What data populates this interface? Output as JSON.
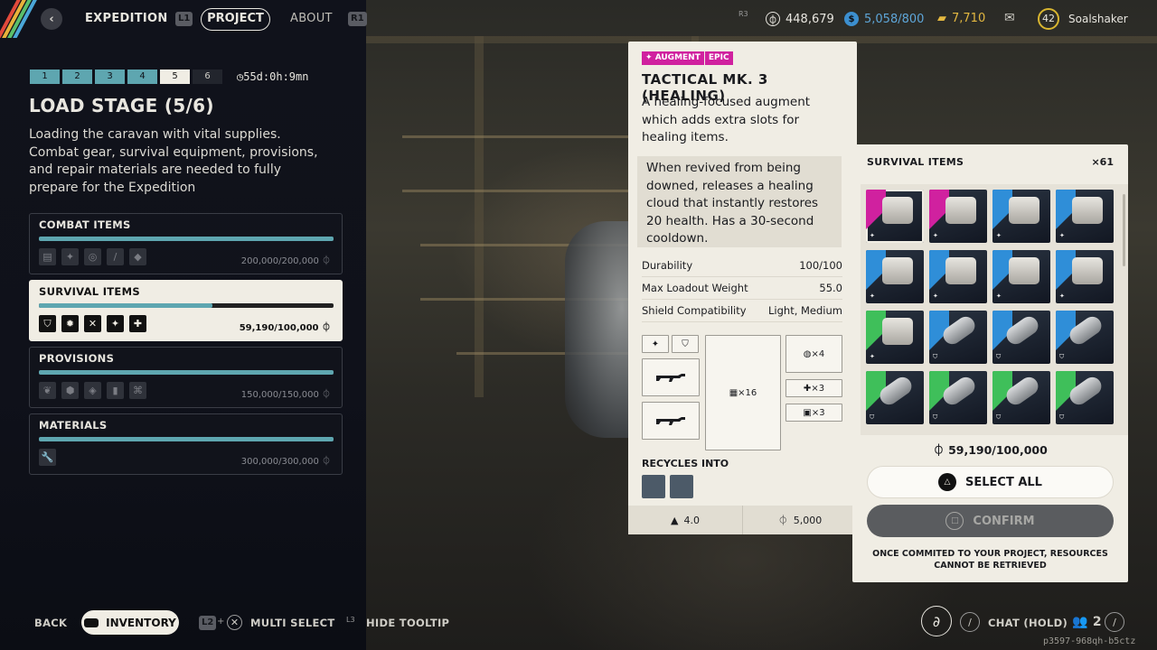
{
  "top_nav": {
    "back_label": "‹",
    "expedition": "EXPEDITION",
    "l1": "L1",
    "project": "PROJECT",
    "about": "ABOUT",
    "r1": "R1",
    "r3": "R3",
    "credits": "448,679",
    "bar_currency": "5,058/800",
    "premium": "7,710",
    "player_level": "42",
    "player_name": "Soalshaker"
  },
  "stage": {
    "steps": [
      "1",
      "2",
      "3",
      "4",
      "5",
      "6"
    ],
    "active_step": 5,
    "timer": "55d:0h:9mn",
    "title": "LOAD STAGE (5/6)",
    "description": "Loading the caravan with vital supplies. Combat gear, survival equipment, provisions, and repair materials are needed to fully prepare for the Expedition"
  },
  "categories": [
    {
      "name": "COMBAT ITEMS",
      "amount": "200,000/200,000",
      "progress": 1.0,
      "icons": [
        "▤",
        "✦",
        "◎",
        "/",
        "◆"
      ]
    },
    {
      "name": "SURVIVAL ITEMS",
      "amount": "59,190/100,000",
      "progress": 0.59,
      "icons": [
        "⛉",
        "✹",
        "✕",
        "✦",
        "✚"
      ]
    },
    {
      "name": "PROVISIONS",
      "amount": "150,000/150,000",
      "progress": 1.0,
      "icons": [
        "❦",
        "⬢",
        "◈",
        "▮",
        "⌘"
      ]
    },
    {
      "name": "MATERIALS",
      "amount": "300,000/300,000",
      "progress": 1.0,
      "icons": [
        "🔧"
      ]
    }
  ],
  "currency_symbol": "⏀",
  "tooltip": {
    "tag_type": "AUGMENT",
    "tag_rarity": "EPIC",
    "title": "TACTICAL MK. 3 (HEALING)",
    "description": "A healing-focused augment which adds extra slots for healing items.",
    "effect": "When revived from being downed, releases a healing cloud that instantly restores 20 health. Has a 30-second cooldown.",
    "stats": [
      {
        "label": "Durability",
        "value": "100/100"
      },
      {
        "label": "Max Loadout Weight",
        "value": "55.0"
      },
      {
        "label": "Shield Compatibility",
        "value": "Light, Medium"
      }
    ],
    "slots": {
      "backpack": "×16",
      "quick_use": "×4",
      "healing": "×3",
      "safe": "×3"
    },
    "recycles_label": "RECYCLES INTO",
    "weight": "4.0",
    "value": "5,000"
  },
  "survival_panel": {
    "title": "SURVIVAL ITEMS",
    "count": "×61",
    "total": "59,190/100,000",
    "select_all": "SELECT ALL",
    "confirm": "CONFIRM",
    "warning": "ONCE COMMITED TO YOUR PROJECT, RESOURCES CANNOT BE RETRIEVED",
    "items": [
      {
        "rarity": "#d0219f",
        "kind": "box",
        "mark": "✦"
      },
      {
        "rarity": "#d0219f",
        "kind": "box",
        "mark": "✦"
      },
      {
        "rarity": "#2f8ed8",
        "kind": "box",
        "mark": "✦"
      },
      {
        "rarity": "#2f8ed8",
        "kind": "box",
        "mark": "✦"
      },
      {
        "rarity": "#2f8ed8",
        "kind": "box",
        "mark": "✦"
      },
      {
        "rarity": "#2f8ed8",
        "kind": "box",
        "mark": "✦"
      },
      {
        "rarity": "#2f8ed8",
        "kind": "box",
        "mark": "✦"
      },
      {
        "rarity": "#2f8ed8",
        "kind": "box",
        "mark": "✦"
      },
      {
        "rarity": "#3fbf5a",
        "kind": "box",
        "mark": "✦"
      },
      {
        "rarity": "#2f8ed8",
        "kind": "tube",
        "mark": "⛉"
      },
      {
        "rarity": "#2f8ed8",
        "kind": "tube",
        "mark": "⛉"
      },
      {
        "rarity": "#2f8ed8",
        "kind": "tube",
        "mark": "⛉"
      },
      {
        "rarity": "#3fbf5a",
        "kind": "tube",
        "mark": "⛉"
      },
      {
        "rarity": "#3fbf5a",
        "kind": "tube",
        "mark": "⛉"
      },
      {
        "rarity": "#3fbf5a",
        "kind": "tube",
        "mark": "⛉"
      },
      {
        "rarity": "#3fbf5a",
        "kind": "tube",
        "mark": "⛉"
      }
    ]
  },
  "bottom": {
    "back": "BACK",
    "inventory": "INVENTORY",
    "l2": "L2",
    "multi_select": "MULTI SELECT",
    "l3": "L3",
    "hide_tooltip": "HIDE TOOLTIP",
    "chat": "CHAT (HOLD)",
    "party": "2",
    "session_id": "p3597-968qh-b5ctz"
  },
  "colors": {
    "accent_teal": "#5ea6b0",
    "epic_magenta": "#d0219f",
    "rare_blue": "#2f8ed8",
    "uncommon_green": "#3fbf5a",
    "panel_cream": "#f0ede4"
  }
}
